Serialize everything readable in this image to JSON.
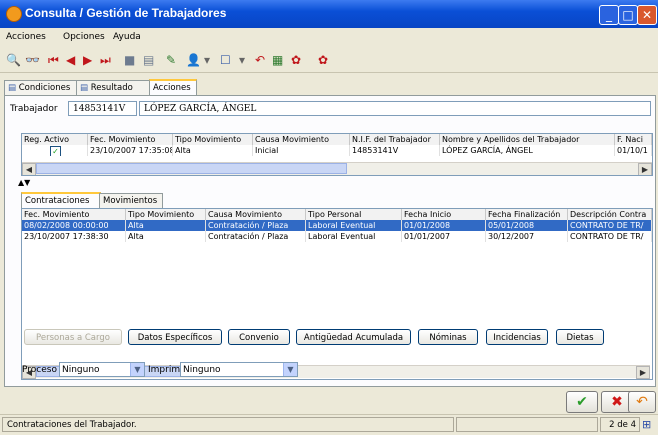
{
  "window": {
    "title": "Consulta / Gestión de Trabajadores"
  },
  "menu": [
    "Acciones",
    "Opciones",
    "Ayuda"
  ],
  "tabs_main": [
    "Condiciones",
    "Resultado",
    "Acciones"
  ],
  "trabajador": {
    "label": "Trabajador",
    "code": "14853141V",
    "name": "LÓPEZ GARCÍA, ÁNGEL"
  },
  "upper_grid": {
    "headers": [
      "Reg. Activo",
      "Fec. Movimiento",
      "Tipo Movimiento",
      "Causa Movimiento",
      "N.I.F. del Trabajador",
      "Nombre y Apellidos del Trabajador",
      "F. Naci"
    ],
    "rows": [
      [
        "",
        "23/10/2007 17:35:08",
        "Alta",
        "Inicial",
        "14853141V",
        "LÓPEZ GARCÍA, ÁNGEL",
        "01/10/1"
      ]
    ]
  },
  "tabs_sub": [
    "Contrataciones",
    "Movimientos"
  ],
  "lower_grid": {
    "headers": [
      "Fec. Movimiento",
      "Tipo Movimiento",
      "Causa Movimiento",
      "Tipo Personal",
      "Fecha Inicio",
      "Fecha Finalización",
      "Descripción Contra"
    ],
    "rows": [
      [
        "08/02/2008 00:00:00",
        "Alta",
        "Contratación / Plaza",
        "Laboral Eventual",
        "01/01/2008",
        "05/01/2008",
        "CONTRATO DE TR/"
      ],
      [
        "23/10/2007 17:38:30",
        "Alta",
        "Contratación / Plaza",
        "Laboral Eventual",
        "01/01/2007",
        "30/12/2007",
        "CONTRATO DE TR/"
      ]
    ]
  },
  "buttons": [
    "Personas a Cargo",
    "Datos Específicos",
    "Convenio",
    "Antigüedad Acumulada",
    "Nóminas",
    "Incidencias",
    "Dietas"
  ],
  "proceso": {
    "label": "Proceso",
    "value": "Ninguno"
  },
  "imprimir": {
    "label": "Imprimir",
    "value": "Ninguno"
  },
  "status": {
    "text": "Contrataciones del Trabajador.",
    "page": "2 de 4"
  }
}
